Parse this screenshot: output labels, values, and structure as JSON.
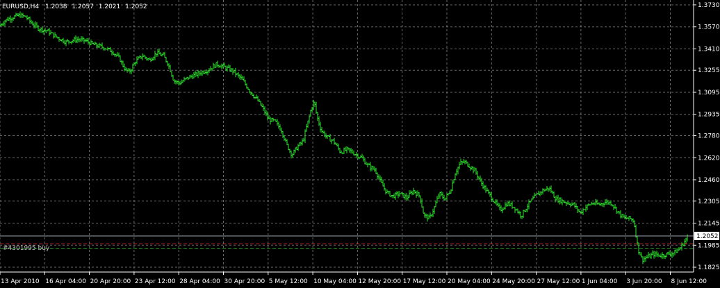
{
  "header": {
    "symbol": "EURUSD,H4",
    "open": "1.2038",
    "high": "1.2057",
    "low": "1.2021",
    "close": "1.2052"
  },
  "order_line": {
    "label": "#4301995 buy",
    "price": 1.1994,
    "color": "#c83232"
  },
  "colors": {
    "background": "#000000",
    "grid": "#c0c0c0",
    "candle": "#32e632",
    "axis": "#ffffff",
    "bid_line": "#9aa4b0",
    "ask_line": "#c83232"
  },
  "chart_data": {
    "type": "candlestick",
    "symbol": "EURUSD",
    "timeframe": "H4",
    "grid": true,
    "ylim": [
      1.179,
      1.3765
    ],
    "y_ticks": [
      "1.3730",
      "1.3570",
      "1.3410",
      "1.3255",
      "1.3095",
      "1.2935",
      "1.2780",
      "1.2620",
      "1.2460",
      "1.2305",
      "1.2145",
      "1.1985",
      "1.1825"
    ],
    "x_ticks": [
      "13 Apr 2010",
      "16 Apr 04:00",
      "20 Apr 20:00",
      "23 Apr 12:00",
      "28 Apr 04:00",
      "30 Apr 20:00",
      "5 May 12:00",
      "10 May 04:00",
      "12 May 20:00",
      "17 May 12:00",
      "20 May 04:00",
      "24 May 20:00",
      "27 May 12:00",
      "1 Jun 04:00",
      "3 Jun 20:00",
      "8 Jun 12:00"
    ],
    "current_price": "1.2052",
    "current_price_value": 1.2052,
    "price_path": [
      [
        0,
        1.358
      ],
      [
        8,
        1.362
      ],
      [
        18,
        1.364
      ],
      [
        28,
        1.3655
      ],
      [
        38,
        1.364
      ],
      [
        45,
        1.36
      ],
      [
        55,
        1.356
      ],
      [
        68,
        1.354
      ],
      [
        80,
        1.35
      ],
      [
        95,
        1.346
      ],
      [
        110,
        1.348
      ],
      [
        122,
        1.347
      ],
      [
        135,
        1.344
      ],
      [
        150,
        1.342
      ],
      [
        162,
        1.339
      ],
      [
        172,
        1.334
      ],
      [
        180,
        1.326
      ],
      [
        186,
        1.324
      ],
      [
        195,
        1.332
      ],
      [
        205,
        1.336
      ],
      [
        215,
        1.333
      ],
      [
        225,
        1.338
      ],
      [
        235,
        1.336
      ],
      [
        242,
        1.33
      ],
      [
        250,
        1.318
      ],
      [
        258,
        1.316
      ],
      [
        270,
        1.32
      ],
      [
        285,
        1.323
      ],
      [
        300,
        1.326
      ],
      [
        312,
        1.33
      ],
      [
        322,
        1.328
      ],
      [
        335,
        1.325
      ],
      [
        348,
        1.319
      ],
      [
        360,
        1.31
      ],
      [
        370,
        1.304
      ],
      [
        378,
        1.298
      ],
      [
        386,
        1.29
      ],
      [
        396,
        1.288
      ],
      [
        405,
        1.282
      ],
      [
        412,
        1.272
      ],
      [
        420,
        1.264
      ],
      [
        428,
        1.27
      ],
      [
        436,
        1.274
      ],
      [
        442,
        1.286
      ],
      [
        448,
        1.298
      ],
      [
        452,
        1.303
      ],
      [
        456,
        1.292
      ],
      [
        462,
        1.282
      ],
      [
        470,
        1.277
      ],
      [
        480,
        1.274
      ],
      [
        490,
        1.266
      ],
      [
        500,
        1.268
      ],
      [
        510,
        1.265
      ],
      [
        520,
        1.262
      ],
      [
        530,
        1.256
      ],
      [
        540,
        1.253
      ],
      [
        548,
        1.244
      ],
      [
        556,
        1.237
      ],
      [
        565,
        1.234
      ],
      [
        575,
        1.236
      ],
      [
        585,
        1.233
      ],
      [
        595,
        1.238
      ],
      [
        604,
        1.234
      ],
      [
        610,
        1.22
      ],
      [
        618,
        1.218
      ],
      [
        625,
        1.226
      ],
      [
        632,
        1.236
      ],
      [
        640,
        1.232
      ],
      [
        648,
        1.238
      ],
      [
        655,
        1.251
      ],
      [
        662,
        1.258
      ],
      [
        668,
        1.259
      ],
      [
        676,
        1.256
      ],
      [
        684,
        1.252
      ],
      [
        692,
        1.244
      ],
      [
        700,
        1.238
      ],
      [
        710,
        1.231
      ],
      [
        720,
        1.224
      ],
      [
        730,
        1.229
      ],
      [
        740,
        1.226
      ],
      [
        750,
        1.22
      ],
      [
        760,
        1.228
      ],
      [
        770,
        1.234
      ],
      [
        780,
        1.238
      ],
      [
        790,
        1.24
      ],
      [
        800,
        1.232
      ],
      [
        812,
        1.23
      ],
      [
        825,
        1.228
      ],
      [
        835,
        1.222
      ],
      [
        842,
        1.226
      ],
      [
        852,
        1.229
      ],
      [
        862,
        1.228
      ],
      [
        872,
        1.23
      ],
      [
        880,
        1.229
      ],
      [
        890,
        1.222
      ],
      [
        898,
        1.218
      ],
      [
        906,
        1.218
      ],
      [
        912,
        1.216
      ],
      [
        918,
        1.196
      ],
      [
        924,
        1.188
      ],
      [
        932,
        1.19
      ],
      [
        940,
        1.192
      ],
      [
        950,
        1.191
      ],
      [
        960,
        1.192
      ],
      [
        970,
        1.193
      ],
      [
        978,
        1.196
      ],
      [
        986,
        1.202
      ],
      [
        990,
        1.2052
      ]
    ]
  }
}
